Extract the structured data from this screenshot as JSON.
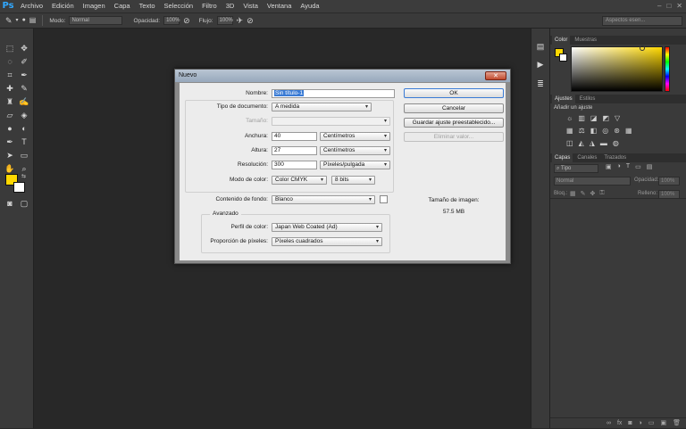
{
  "app": {
    "logo": "Ps"
  },
  "menubar": {
    "items": [
      "Archivo",
      "Edición",
      "Imagen",
      "Capa",
      "Texto",
      "Selección",
      "Filtro",
      "3D",
      "Vista",
      "Ventana",
      "Ayuda"
    ]
  },
  "window_controls": {
    "minimize": "–",
    "maximize": "□",
    "close": "✕"
  },
  "options_bar": {
    "mode_label": "Modo:",
    "mode_value": "Normal",
    "opacity_label": "Opacidad:",
    "opacity_value": "100%",
    "flow_label": "Flujo:",
    "flow_value": "100%",
    "workspace": "Aspectos esen..."
  },
  "colors": {
    "foreground": "#ffd800",
    "background": "#ffffff",
    "accent": "#3a7bd5"
  },
  "panels": {
    "color_tabs": [
      "Color",
      "Muestras"
    ],
    "adjust_tabs": [
      "Ajustes",
      "Estilos"
    ],
    "adjust_title": "Añadir un ajuste",
    "layers_tabs": [
      "Capas",
      "Canales",
      "Trazados"
    ],
    "layers_filter": "Tipo",
    "layers_blend": "Normal",
    "layers_opacity_label": "Opacidad:",
    "layers_opacity_value": "100%",
    "layers_lock_label": "Bloq.:",
    "layers_fill_label": "Relleno:",
    "layers_fill_value": "100%"
  },
  "dialog": {
    "title": "Nuevo",
    "close": "✕",
    "name_label": "Nombre:",
    "name_value": "Sin título-1",
    "doc_type_label": "Tipo de documento:",
    "doc_type_value": "A medida",
    "size_label": "Tamaño:",
    "size_value": "",
    "width_label": "Anchura:",
    "width_value": "40",
    "width_unit": "Centímetros",
    "height_label": "Altura:",
    "height_value": "27",
    "height_unit": "Centímetros",
    "resolution_label": "Resolución:",
    "resolution_value": "300",
    "resolution_unit": "Píxeles/pulgada",
    "color_mode_label": "Modo de color:",
    "color_mode_value": "Color CMYK",
    "bit_depth": "8 bits",
    "background_label": "Contenido de fondo:",
    "background_value": "Blanco",
    "advanced_label": "Avanzado",
    "profile_label": "Perfil de color:",
    "profile_value": "Japan Web Coated (Ad)",
    "pixel_ratio_label": "Proporción de píxeles:",
    "pixel_ratio_value": "Píxeles cuadrados",
    "ok": "OK",
    "cancel": "Cancelar",
    "save_preset": "Guardar ajuste preestablecido...",
    "delete_preset": "Eliminar valor...",
    "image_size_label": "Tamaño de imagen:",
    "image_size_value": "57.5 MB"
  }
}
